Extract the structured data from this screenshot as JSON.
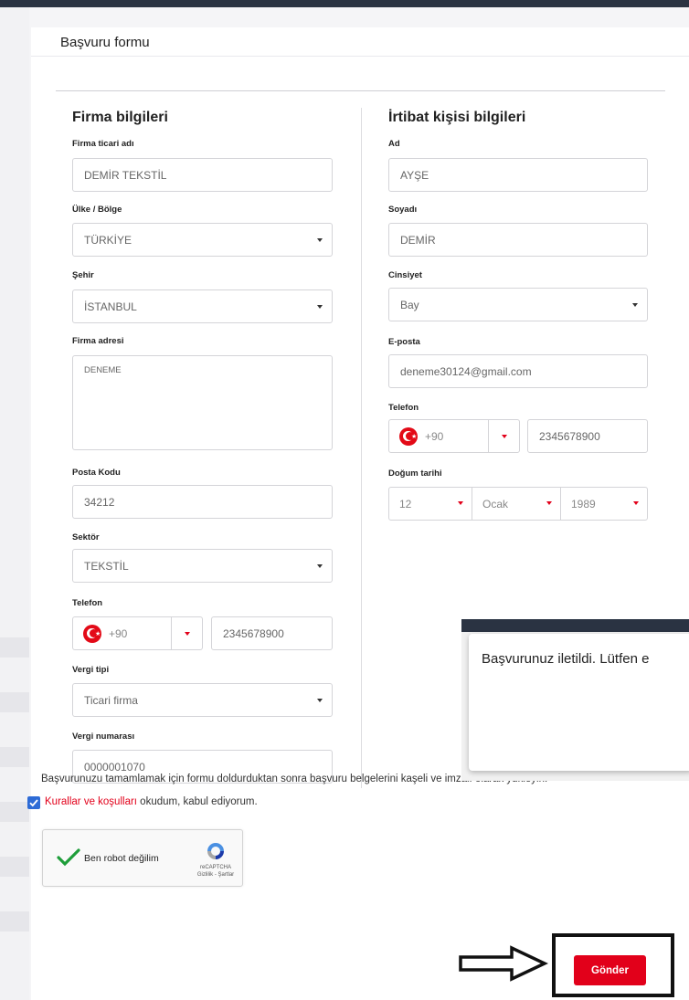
{
  "page_title": "Başvuru formu",
  "company": {
    "section_title": "Firma bilgileri",
    "trade_name": {
      "label": "Firma ticari adı",
      "value": "DEMİR TEKSTİL"
    },
    "country": {
      "label": "Ülke / Bölge",
      "value": "TÜRKİYE"
    },
    "city": {
      "label": "Şehir",
      "value": "İSTANBUL"
    },
    "address": {
      "label": "Firma adresi",
      "value": "DENEME"
    },
    "postal_code": {
      "label": "Posta Kodu",
      "value": "34212"
    },
    "sector": {
      "label": "Sektör",
      "value": "TEKSTİL"
    },
    "phone": {
      "label": "Telefon",
      "code": "+90",
      "number": "2345678900"
    },
    "tax_type": {
      "label": "Vergi tipi",
      "value": "Ticari firma"
    },
    "tax_number": {
      "label": "Vergi numarası",
      "value": "0000001070"
    }
  },
  "contact": {
    "section_title": "İrtibat kişisi bilgileri",
    "first_name": {
      "label": "Ad",
      "value": "AYŞE"
    },
    "last_name": {
      "label": "Soyadı",
      "value": "DEMİR"
    },
    "gender": {
      "label": "Cinsiyet",
      "value": "Bay"
    },
    "email": {
      "label": "E-posta",
      "value": "deneme30124@gmail.com"
    },
    "phone": {
      "label": "Telefon",
      "code": "+90",
      "number": "2345678900"
    },
    "birth_date": {
      "label": "Doğum tarihi",
      "day": "12",
      "month": "Ocak",
      "year": "1989"
    }
  },
  "note": "Başvurunuzu tamamlamak için formu doldurduktan sonra başvuru belgelerini kaşeli ve imzalı olarak yükleyin.",
  "terms": {
    "link": "Kurallar ve koşulları",
    "text": " okudum, kabul ediyorum.",
    "checked": true
  },
  "captcha": {
    "label": "Ben robot değilim",
    "brand": "reCAPTCHA",
    "links": "Gizlilik - Şartlar"
  },
  "toast": {
    "message": "Başvurunuz iletildi. Lütfen e"
  },
  "submit_label": "Gönder",
  "colors": {
    "accent": "#e2001a",
    "checkbox": "#2d6bd6",
    "header": "#2a3342"
  },
  "icons": {
    "flag": "turkey-flag-icon",
    "arrow": "right-arrow-icon",
    "captcha": "recaptcha-logo-icon"
  }
}
